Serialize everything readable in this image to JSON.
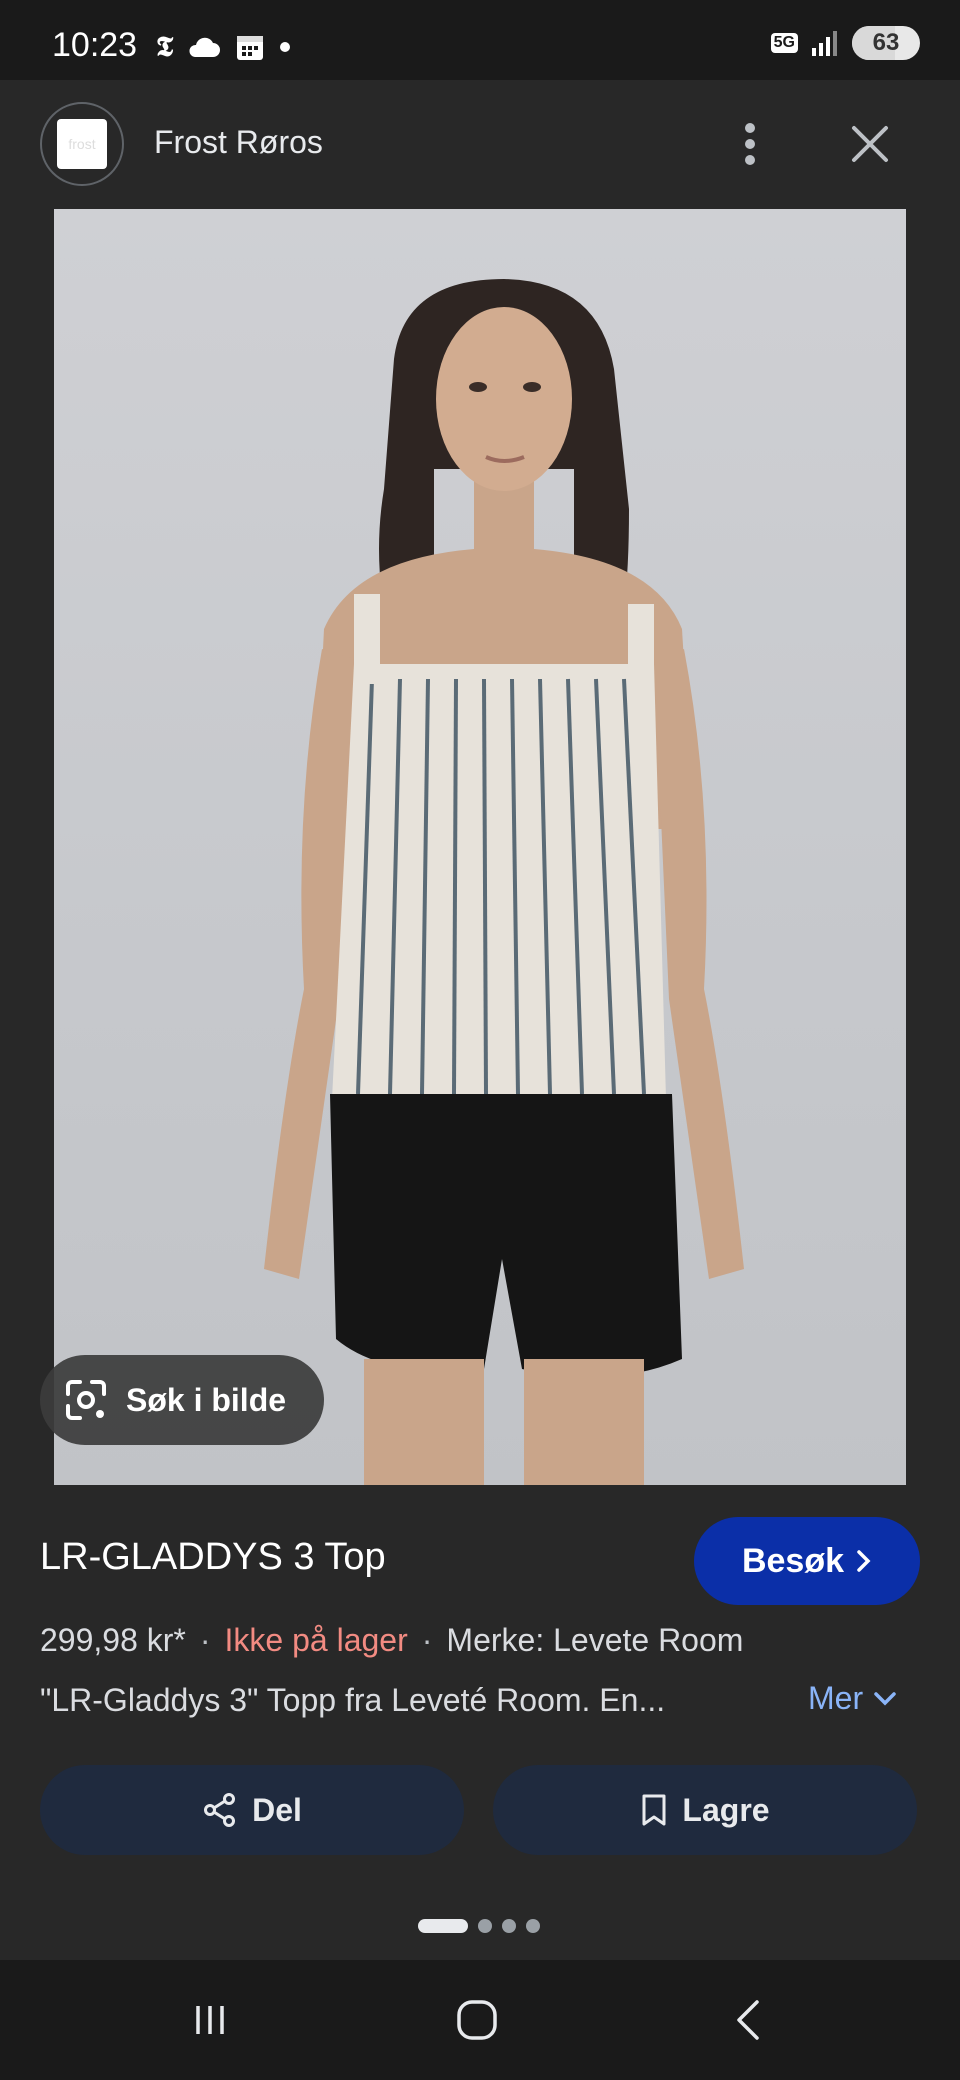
{
  "status_bar": {
    "time": "10:23",
    "network": "5G",
    "battery": "63",
    "battery_level_percent": 63
  },
  "header": {
    "site_name": "Frost Røros",
    "logo_text": "frost"
  },
  "image": {
    "lens_button_label": "Søk i bilde"
  },
  "product": {
    "title": "LR-GLADDYS 3 Top",
    "visit_label": "Besøk",
    "price": "299,98 kr*",
    "separator": "·",
    "stock_status": "Ikke på lager",
    "brand": "Merke: Levete Room",
    "description": "\"LR-Gladdys 3\" Topp fra Leveté Room. En...",
    "more_label": "Mer"
  },
  "actions": {
    "share_label": "Del",
    "save_label": "Lagre"
  },
  "colors": {
    "accent_button": "#0b2fa8",
    "link": "#8ab4f8",
    "stock_warning": "#f28b82"
  }
}
